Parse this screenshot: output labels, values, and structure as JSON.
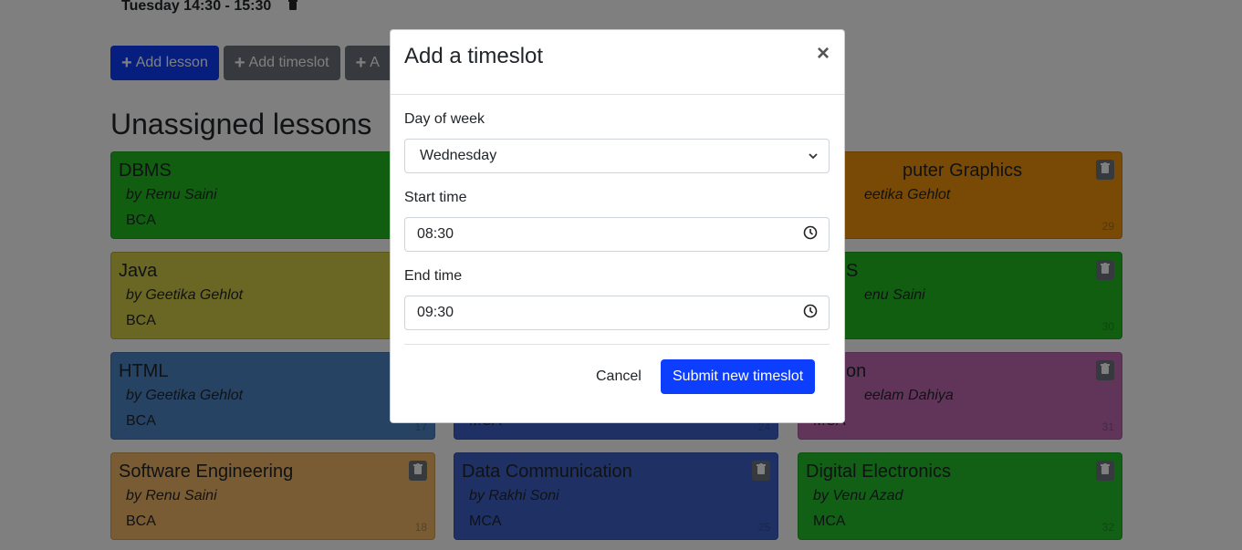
{
  "header": {
    "timeslot_text": "Tuesday 14:30 - 15:30"
  },
  "toolbar": {
    "add_lesson_label": "Add lesson",
    "add_timeslot_label": "Add timeslot",
    "add_third_label": "A"
  },
  "section": {
    "title": "Unassigned lessons"
  },
  "lessons": [
    {
      "subject": "DBMS",
      "teacher": "by Renu Saini",
      "group": "BCA",
      "id": "",
      "color": "#22bd22"
    },
    {
      "subject": "Java",
      "teacher": "by Geetika Gehlot",
      "group": "BCA",
      "id": "",
      "color": "#d4cc48"
    },
    {
      "subject": "HTML",
      "teacher": "by Geetika Gehlot",
      "group": "BCA",
      "id": "17",
      "color": "#4d87c9"
    },
    {
      "subject": "Software Engineering",
      "teacher": "by Renu Saini",
      "group": "BCA",
      "id": "18",
      "color": "#f3b867"
    },
    {
      "subject": "",
      "teacher": "",
      "group": "MCA",
      "id": "24",
      "color": "#3f63c9"
    },
    {
      "subject": "Data Communication",
      "teacher": "by Rakhi Soni",
      "group": "MCA",
      "id": "25",
      "color": "#3f63c9"
    },
    {
      "subject": "puter Graphics",
      "teacher": "eetika Gehlot",
      "group": "",
      "id": "29",
      "color": "#f0950a"
    },
    {
      "subject": "S",
      "teacher": "enu Saini",
      "group": "",
      "id": "30",
      "color": "#22bd22"
    },
    {
      "subject": "on",
      "teacher": "eelam Dahiya",
      "group": "MCA",
      "id": "31",
      "color": "#c26bb3"
    },
    {
      "subject": "Digital Electronics",
      "teacher": "by Venu Azad",
      "group": "MCA",
      "id": "32",
      "color": "#22c12b"
    }
  ],
  "modal": {
    "title": "Add a timeslot",
    "close_glyph": "×",
    "day_label": "Day of week",
    "day_value": "Wednesday",
    "start_label": "Start time",
    "start_value": "08:30",
    "end_label": "End time",
    "end_value": "09:30",
    "cancel_label": "Cancel",
    "submit_label": "Submit new timeslot"
  }
}
